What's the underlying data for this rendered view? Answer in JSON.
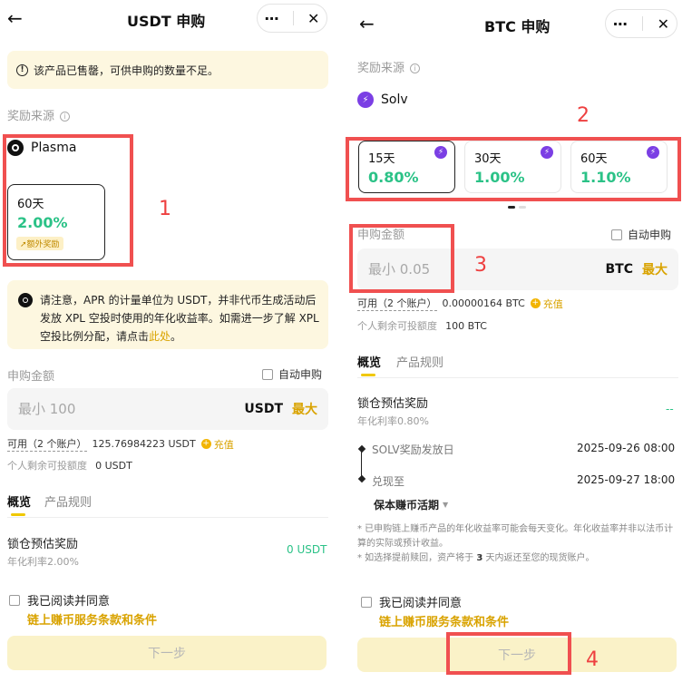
{
  "left": {
    "title": "USDT 申购",
    "more_icon": "⋯",
    "close_icon": "✕",
    "notice": "该产品已售罄，可供申购的数量不足。",
    "reward_source_label": "奖励来源",
    "provider": "Plasma",
    "term": {
      "days": "60天",
      "rate": "2.00%",
      "bonus": "额外奖励"
    },
    "marker": "1",
    "apr_notice_pre": "请注意，APR 的计量单位为 USDT，并非代币生成活动后发放 XPL 空投时使用的年化收益率。如需进一步了解 XPL 空投比例分配，请点击",
    "apr_notice_link": "此处",
    "apr_notice_post": "。",
    "amount_label": "申购金额",
    "auto_subscribe": "自动申购",
    "amount_placeholder": "最小 100",
    "unit": "USDT",
    "max": "最大",
    "available_label": "可用（2 个账户）",
    "available_value": "125.76984223 USDT",
    "deposit": "充值",
    "remaining_label": "个人剩余可投额度",
    "remaining_value": "0 USDT",
    "tab_overview": "概览",
    "tab_rules": "产品规则",
    "locked_reward_label": "锁仓预估奖励",
    "apr_line": "年化利率2.00%",
    "locked_reward_value": "0 USDT",
    "agree_label": "我已阅读并同意",
    "terms_link": "链上赚币服务条款和条件",
    "next": "下一步"
  },
  "right": {
    "title": "BTC 申购",
    "more_icon": "⋯",
    "close_icon": "✕",
    "reward_source_label": "奖励来源",
    "provider": "Solv",
    "terms": [
      {
        "days": "15天",
        "rate": "0.80%"
      },
      {
        "days": "30天",
        "rate": "1.00%"
      },
      {
        "days": "60天",
        "rate": "1.10%"
      }
    ],
    "markers": [
      "2",
      "3",
      "4"
    ],
    "amount_label": "申购金额",
    "auto_subscribe": "自动申购",
    "amount_placeholder": "最小 0.05",
    "unit": "BTC",
    "max": "最大",
    "available_label": "可用（2 个账户）",
    "available_value": "0.00000164 BTC",
    "deposit": "充值",
    "remaining_label": "个人剩余可投额度",
    "remaining_value": "100 BTC",
    "tab_overview": "概览",
    "tab_rules": "产品规则",
    "locked_reward_label": "锁仓预估奖励",
    "apr_line": "年化利率0.80%",
    "locked_reward_value": "--",
    "timeline": [
      {
        "label": "SOLV奖励发放日",
        "value": "2025-09-26 08:00"
      },
      {
        "label": "兑现至",
        "value": "2025-09-27 18:00"
      }
    ],
    "dropdown": "保本赚币活期",
    "note1": "* 已申购链上赚币产品的年化收益率可能会每天变化。年化收益率并非以法币计算的实际或预计收益。",
    "note2_pre": "* 如选择提前赎回，资产将于 ",
    "note2_bold": "3",
    "note2_post": " 天内返还至您的现货账户。",
    "agree_label": "我已阅读并同意",
    "terms_link": "链上赚币服务条款和条件",
    "next": "下一步"
  }
}
